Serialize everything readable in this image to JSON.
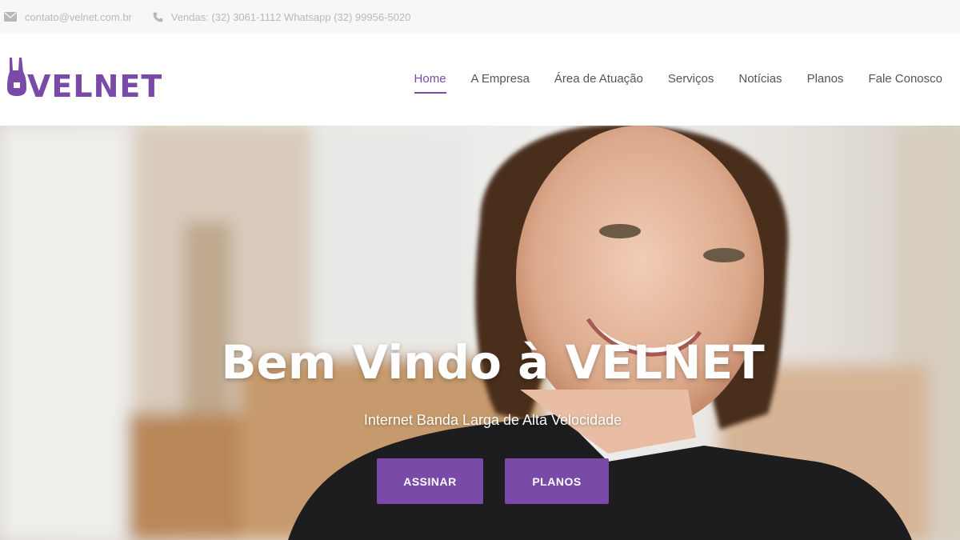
{
  "topbar": {
    "email": "contato@velnet.com.br",
    "phone": "Vendas: (32) 3061-1112 Whatsapp (32) 99956-5020",
    "email_icon": "envelope-icon",
    "phone_icon": "phone-icon"
  },
  "brand": {
    "name": "VELNET",
    "color": "#7a4aa8"
  },
  "nav": {
    "items": [
      {
        "label": "Home",
        "active": true
      },
      {
        "label": "A Empresa"
      },
      {
        "label": "Área de Atuação"
      },
      {
        "label": "Serviços"
      },
      {
        "label": "Notícias"
      },
      {
        "label": "Planos"
      },
      {
        "label": "Fale Conosco"
      }
    ]
  },
  "hero": {
    "title": "Bem Vindo à VELNET",
    "subtitle": "Internet Banda Larga de Alta Velocidade",
    "buttons": {
      "assinar": "ASSINAR",
      "planos": "PLANOS"
    }
  }
}
